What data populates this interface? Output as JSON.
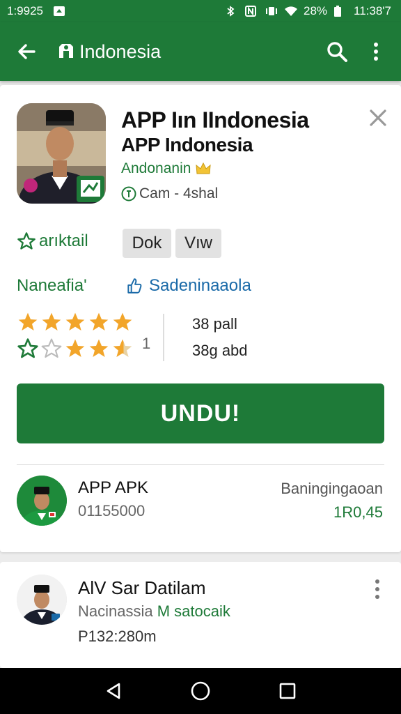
{
  "status_bar": {
    "time": "1:9925",
    "battery": "28%",
    "clock_right": "11:38'7"
  },
  "toolbar": {
    "title": "Indonesia"
  },
  "app": {
    "title": "APP Iın IIndonesia",
    "subtitle": "APP Indonesia",
    "developer": "Andonanin",
    "meta": "Cam - 4shal",
    "wishlist_label": "arıktail",
    "chips": [
      "Dok",
      "Vıw"
    ],
    "category": "Naneafia'",
    "share_label": "Sadeninaaola",
    "rating_value": "5",
    "review_count": "1",
    "stat1": "38 pall",
    "stat2": "38g abd",
    "install_label": "UNDU!"
  },
  "related": [
    {
      "title": "APP APK",
      "subtitle": "01155000",
      "right_top": "Baningingaoan",
      "right_bottom": "1R0,45"
    },
    {
      "title": "AlV Sar Datilam",
      "subtitle_gray": "Nacinassia",
      "subtitle_green": "M satocaik",
      "price": "P132:280m"
    }
  ],
  "colors": {
    "primary": "#1e7a38",
    "star": "#f2a52a",
    "link": "#1a6aa8"
  },
  "icons": [
    "back-arrow-icon",
    "store-icon",
    "search-icon",
    "more-vert-icon",
    "close-icon",
    "crown-icon",
    "info-icon",
    "star-outline-icon",
    "share-icon",
    "star-icon",
    "nav-back-icon",
    "nav-home-icon",
    "nav-recents-icon"
  ]
}
